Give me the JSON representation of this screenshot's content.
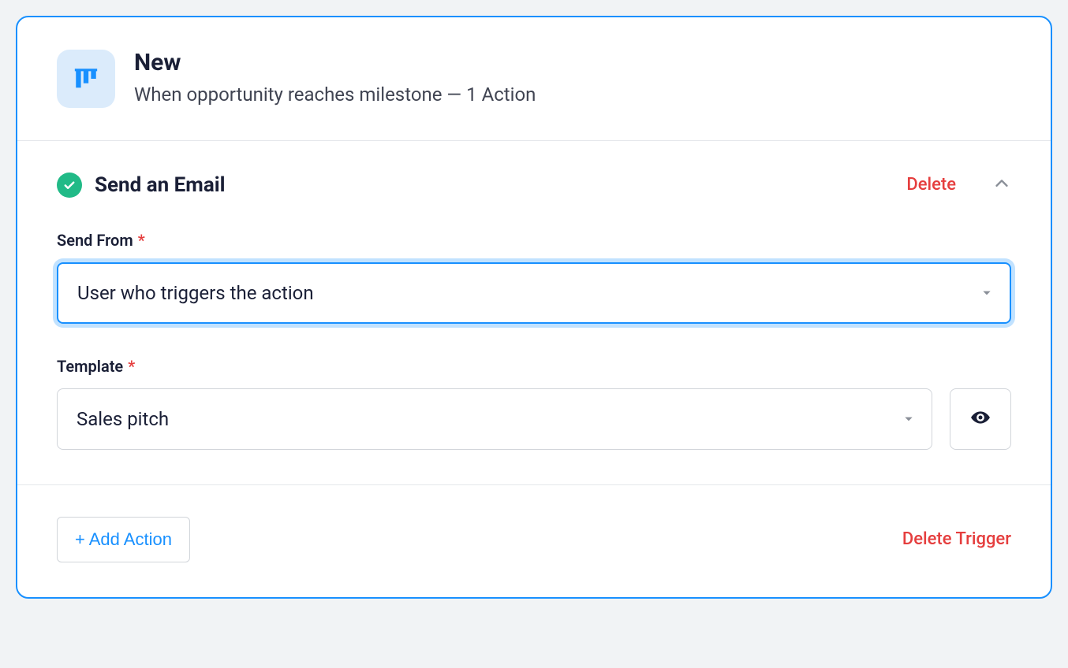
{
  "header": {
    "title": "New",
    "subtitle": "When opportunity reaches milestone — 1 Action"
  },
  "action": {
    "title": "Send an Email",
    "delete_label": "Delete",
    "fields": {
      "send_from": {
        "label": "Send From",
        "value": "User who triggers the action"
      },
      "template": {
        "label": "Template",
        "value": "Sales pitch"
      }
    }
  },
  "footer": {
    "add_action_label": "+ Add Action",
    "delete_trigger_label": "Delete Trigger"
  }
}
